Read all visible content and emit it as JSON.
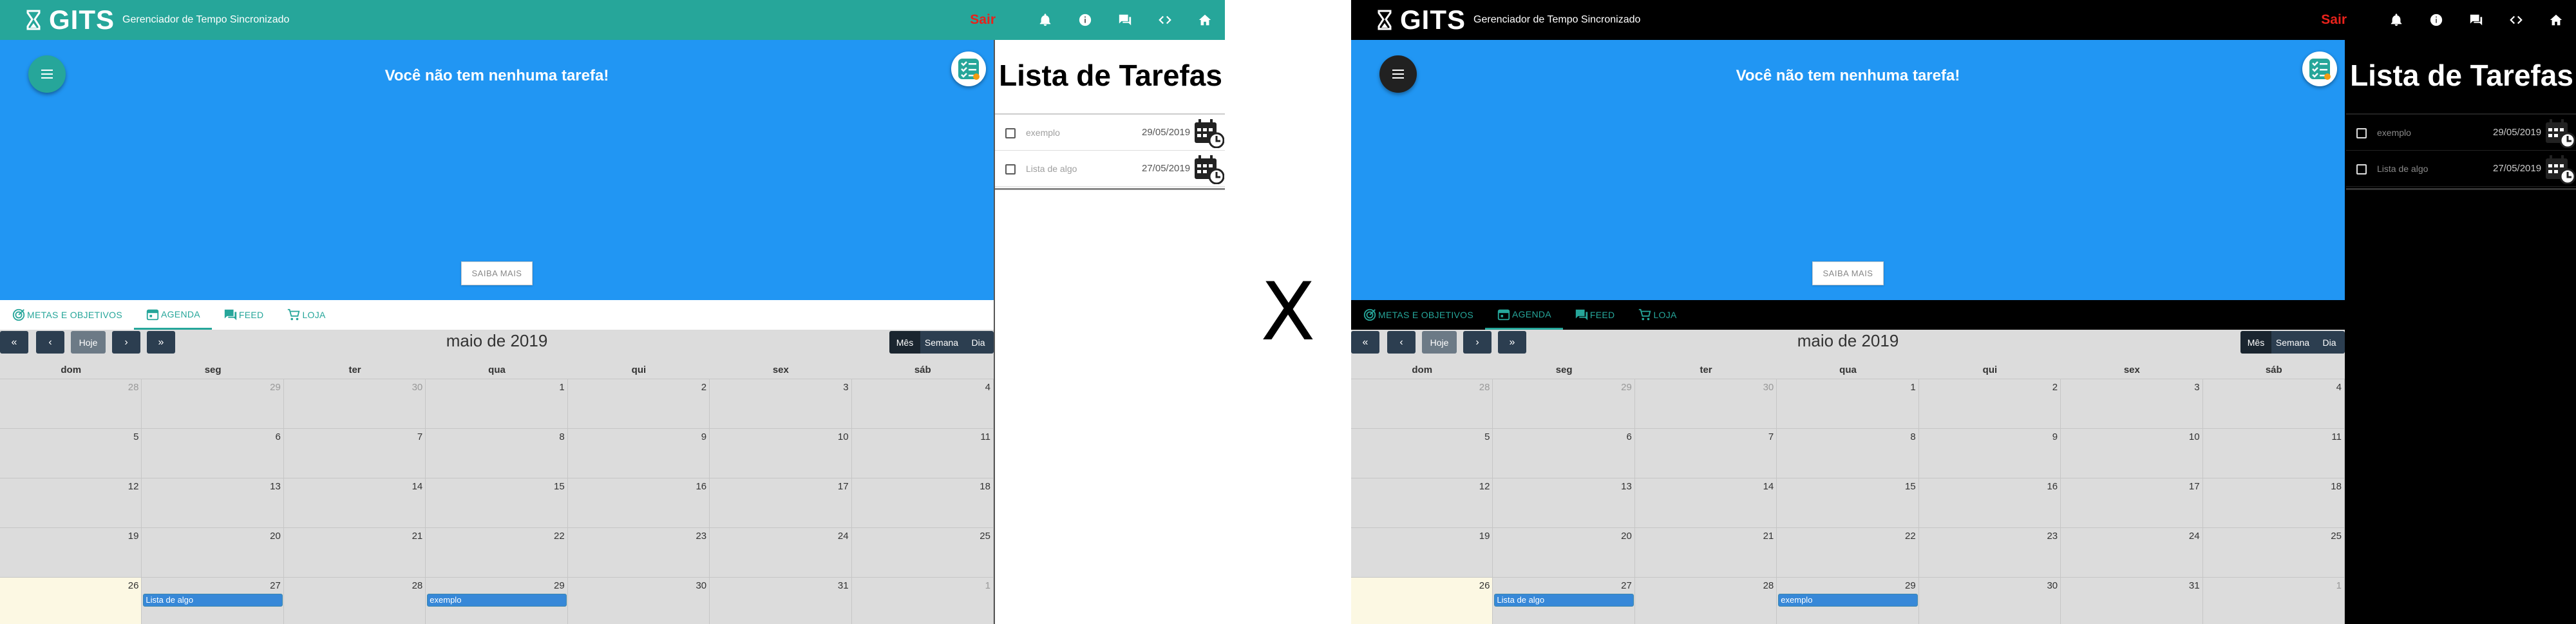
{
  "app": {
    "brand": "GITS",
    "tagline": "Gerenciador de Tempo Sincronizado",
    "logout_label": "Sair",
    "top_icons": [
      "bell-icon",
      "info-icon",
      "chat-icon",
      "code-icon",
      "home-icon"
    ]
  },
  "separator": "X",
  "hero": {
    "message": "Você não tem nenhuma tarefa!",
    "learn_more": "SAIBA MAIS"
  },
  "tabs": [
    {
      "label": "METAS E OBJETIVOS",
      "icon": "target-icon",
      "active": false
    },
    {
      "label": "AGENDA",
      "icon": "calendar-icon",
      "active": true
    },
    {
      "label": "FEED",
      "icon": "chat-icon",
      "active": false
    },
    {
      "label": "LOJA",
      "icon": "cart-icon",
      "active": false
    }
  ],
  "calendar": {
    "title": "maio de 2019",
    "today_label": "Hoje",
    "nav": {
      "prev_year": "«",
      "prev": "‹",
      "next": "›",
      "next_year": "»"
    },
    "views": [
      "Mês",
      "Semana",
      "Dia"
    ],
    "active_view": "Mês",
    "weekdays": [
      "dom",
      "seg",
      "ter",
      "qua",
      "qui",
      "sex",
      "sáb"
    ],
    "weeks": [
      [
        {
          "d": "28",
          "o": true
        },
        {
          "d": "29",
          "o": true
        },
        {
          "d": "30",
          "o": true
        },
        {
          "d": "1"
        },
        {
          "d": "2"
        },
        {
          "d": "3"
        },
        {
          "d": "4"
        }
      ],
      [
        {
          "d": "5"
        },
        {
          "d": "6"
        },
        {
          "d": "7"
        },
        {
          "d": "8"
        },
        {
          "d": "9"
        },
        {
          "d": "10"
        },
        {
          "d": "11"
        }
      ],
      [
        {
          "d": "12"
        },
        {
          "d": "13"
        },
        {
          "d": "14"
        },
        {
          "d": "15"
        },
        {
          "d": "16"
        },
        {
          "d": "17"
        },
        {
          "d": "18"
        }
      ],
      [
        {
          "d": "19"
        },
        {
          "d": "20"
        },
        {
          "d": "21"
        },
        {
          "d": "22"
        },
        {
          "d": "23"
        },
        {
          "d": "24"
        },
        {
          "d": "25"
        }
      ],
      [
        {
          "d": "26",
          "today": true
        },
        {
          "d": "27"
        },
        {
          "d": "28"
        },
        {
          "d": "29"
        },
        {
          "d": "30"
        },
        {
          "d": "31"
        },
        {
          "d": "1",
          "o": true
        }
      ]
    ],
    "events": [
      {
        "title": "Lista de algo",
        "week": 4,
        "day": 1
      },
      {
        "title": "exemplo",
        "week": 4,
        "day": 3
      }
    ]
  },
  "task_list": {
    "title": "Lista de Tarefas",
    "items": [
      {
        "name": "exemplo",
        "date": "29/05/2019"
      },
      {
        "name": "Lista de algo",
        "date": "27/05/2019"
      }
    ]
  },
  "colors": {
    "light_primary": "#26a69a",
    "hero_blue": "#2196f3",
    "dark_bar": "#000000",
    "logout_red": "#e8221b",
    "event_blue": "#3788d8"
  }
}
